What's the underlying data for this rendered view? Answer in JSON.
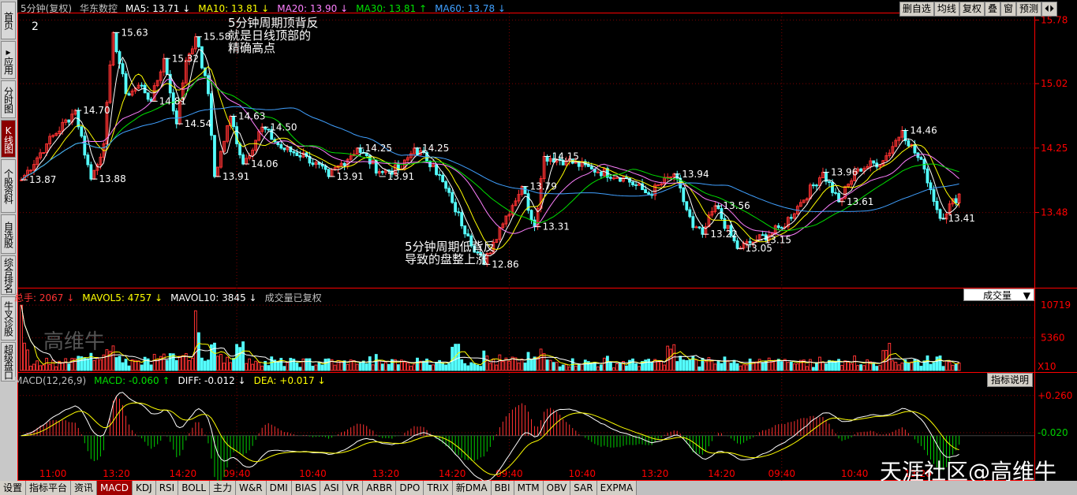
{
  "colors": {
    "up": "#ff3232",
    "down": "#54ffff",
    "ma5": "#ffffff",
    "ma10": "#ffff00",
    "ma20": "#ff80ff",
    "ma30": "#00e000",
    "ma60": "#40a0ff",
    "grid": "#800000",
    "axis": "#ff0000",
    "green": "#00d000"
  },
  "left_tabs": [
    {
      "label": "首页",
      "active": false
    },
    {
      "label": "▸应用",
      "active": false
    },
    {
      "label": "分时图",
      "active": false
    },
    {
      "label": "K线图",
      "active": true
    },
    {
      "label": "个股资料",
      "active": false
    },
    {
      "label": "自选股",
      "active": false
    },
    {
      "label": "综合排名",
      "active": false
    },
    {
      "label": "牛叉诊股",
      "active": false
    },
    {
      "label": "超级盘口",
      "active": false
    }
  ],
  "header": {
    "period": "5分钟(复权)",
    "stock": "华东数控",
    "ma5": "MA5: 13.71 ↓",
    "ma10": "MA10: 13.81 ↓",
    "ma20": "MA20: 13.90 ↓",
    "ma30": "MA30: 13.81 ↑",
    "ma60": "MA60: 13.78 ↓"
  },
  "top_buttons": [
    "删自选",
    "均线",
    "复权",
    "叠",
    "窗",
    "预测"
  ],
  "nav_icon": "prev-next-icon",
  "main_label": "2",
  "price_axis": [
    {
      "v": 15.78,
      "label": "15.78"
    },
    {
      "v": 15.02,
      "label": "15.02"
    },
    {
      "v": 14.25,
      "label": "14.25"
    },
    {
      "v": 13.48,
      "label": "13.48"
    }
  ],
  "annotations": [
    {
      "lines": [
        "5分钟周期顶背反",
        "就是日线顶部的",
        "精确高点"
      ]
    },
    {
      "lines": [
        "5分钟周期低背反",
        "导致的盘整上涨"
      ]
    }
  ],
  "watermark": "高维牛",
  "watermark2": "天涯社区@高维牛",
  "volume_header": {
    "total": "总手: 2067 ↓",
    "mavol5": "MAVOL5: 4757 ↓",
    "mavol10": "MAVOL10: 3845 ↓",
    "note": "成交量已复权"
  },
  "volume_dropdown": "成交量",
  "volume_axis": [
    {
      "v": 10719,
      "label": "10719"
    },
    {
      "v": 5360,
      "label": "5360"
    }
  ],
  "volume_unit": "X10",
  "macd_header": {
    "name": "MACD(12,26,9)",
    "macd": "MACD: -0.060 ↑",
    "diff": "DIFF: -0.012 ↓",
    "dea": "DEA: +0.017 ↓"
  },
  "macd_help": "指标说明",
  "macd_axis": [
    {
      "v": 0.26,
      "label": "+0.260"
    },
    {
      "v": 0.02,
      "label": "-0.020"
    }
  ],
  "time_labels": [
    {
      "i": 10,
      "label": "11:00"
    },
    {
      "i": 30,
      "label": "13:20"
    },
    {
      "i": 51,
      "label": "14:20"
    },
    {
      "i": 68,
      "label": "09:40"
    },
    {
      "i": 92,
      "label": "10:40"
    },
    {
      "i": 115,
      "label": "13:20"
    },
    {
      "i": 136,
      "label": "14:20"
    },
    {
      "i": 154,
      "label": "09:40"
    },
    {
      "i": 177,
      "label": "10:40"
    },
    {
      "i": 200,
      "label": "13:20"
    },
    {
      "i": 221,
      "label": "14:20"
    },
    {
      "i": 240,
      "label": "09:40"
    },
    {
      "i": 263,
      "label": "10:40"
    },
    {
      "i": 283,
      "label": "13:20"
    }
  ],
  "bottom_tabs": [
    {
      "label": "设置",
      "active": false
    },
    {
      "label": "指标平台",
      "active": false
    },
    {
      "label": "资讯",
      "active": false
    },
    {
      "label": "MACD",
      "active": true
    },
    {
      "label": "KDJ",
      "active": false
    },
    {
      "label": "RSI",
      "active": false
    },
    {
      "label": "BOLL",
      "active": false
    },
    {
      "label": "主力",
      "active": false
    },
    {
      "label": "W&R",
      "active": false
    },
    {
      "label": "DMI",
      "active": false
    },
    {
      "label": "BIAS",
      "active": false
    },
    {
      "label": "ASI",
      "active": false
    },
    {
      "label": "VR",
      "active": false
    },
    {
      "label": "ARBR",
      "active": false
    },
    {
      "label": "DPO",
      "active": false
    },
    {
      "label": "TRIX",
      "active": false
    },
    {
      "label": "新DMA",
      "active": false
    },
    {
      "label": "BBI",
      "active": false
    },
    {
      "label": "MTM",
      "active": false
    },
    {
      "label": "OBV",
      "active": false
    },
    {
      "label": "SAR",
      "active": false
    },
    {
      "label": "EXPMA",
      "active": false
    }
  ],
  "chart_data": {
    "type": "candlestick",
    "bars": 320,
    "price_range": [
      12.6,
      15.85
    ],
    "anchors": [
      [
        0,
        13.87
      ],
      [
        8,
        14.3
      ],
      [
        17,
        14.7
      ],
      [
        22,
        13.88
      ],
      [
        26,
        14.3
      ],
      [
        29,
        15.63
      ],
      [
        33,
        14.9
      ],
      [
        38,
        15.0
      ],
      [
        41,
        14.81
      ],
      [
        45,
        15.32
      ],
      [
        49,
        14.54
      ],
      [
        52,
        15.3
      ],
      [
        55,
        15.58
      ],
      [
        59,
        14.9
      ],
      [
        61,
        13.91
      ],
      [
        66,
        14.63
      ],
      [
        70,
        14.06
      ],
      [
        76,
        14.5
      ],
      [
        82,
        14.25
      ],
      [
        90,
        14.15
      ],
      [
        97,
        13.91
      ],
      [
        106,
        14.25
      ],
      [
        113,
        13.97
      ],
      [
        120,
        14.0
      ],
      [
        124,
        14.25
      ],
      [
        130,
        14.05
      ],
      [
        136,
        13.6
      ],
      [
        141,
        13.2
      ],
      [
        146,
        12.86
      ],
      [
        151,
        13.3
      ],
      [
        158,
        13.79
      ],
      [
        162,
        13.31
      ],
      [
        165,
        14.15
      ],
      [
        172,
        14.1
      ],
      [
        180,
        14.0
      ],
      [
        190,
        13.9
      ],
      [
        198,
        13.7
      ],
      [
        206,
        13.94
      ],
      [
        212,
        13.3
      ],
      [
        215,
        13.22
      ],
      [
        219,
        13.56
      ],
      [
        226,
        13.05
      ],
      [
        232,
        13.15
      ],
      [
        240,
        13.3
      ],
      [
        246,
        13.6
      ],
      [
        253,
        13.96
      ],
      [
        258,
        13.61
      ],
      [
        264,
        14.0
      ],
      [
        272,
        14.1
      ],
      [
        278,
        14.46
      ],
      [
        285,
        14.0
      ],
      [
        290,
        13.41
      ],
      [
        296,
        13.7
      ]
    ],
    "labels": [
      {
        "i": 0,
        "v": 13.87,
        "label": "13.87"
      },
      {
        "i": 17,
        "v": 14.7,
        "label": "14.70"
      },
      {
        "i": 22,
        "v": 13.88,
        "label": "13.88"
      },
      {
        "i": 29,
        "v": 15.63,
        "label": "15.63"
      },
      {
        "i": 41,
        "v": 14.81,
        "label": "14.81"
      },
      {
        "i": 45,
        "v": 15.32,
        "label": "15.32"
      },
      {
        "i": 49,
        "v": 14.54,
        "label": "14.54"
      },
      {
        "i": 55,
        "v": 15.58,
        "label": "15.58"
      },
      {
        "i": 61,
        "v": 13.91,
        "label": "13.91"
      },
      {
        "i": 66,
        "v": 14.63,
        "label": "14.63"
      },
      {
        "i": 70,
        "v": 14.06,
        "label": "14.06"
      },
      {
        "i": 76,
        "v": 14.5,
        "label": "14.50"
      },
      {
        "i": 97,
        "v": 13.91,
        "label": "13.91"
      },
      {
        "i": 106,
        "v": 14.25,
        "label": "14.25"
      },
      {
        "i": 113,
        "v": 13.91,
        "label": "13.91"
      },
      {
        "i": 124,
        "v": 14.25,
        "label": "14.25"
      },
      {
        "i": 146,
        "v": 12.86,
        "label": "12.86"
      },
      {
        "i": 158,
        "v": 13.79,
        "label": "13.79"
      },
      {
        "i": 162,
        "v": 13.31,
        "label": "13.31"
      },
      {
        "i": 165,
        "v": 14.15,
        "label": "14.15"
      },
      {
        "i": 206,
        "v": 13.94,
        "label": "13.94"
      },
      {
        "i": 215,
        "v": 13.22,
        "label": "13.22"
      },
      {
        "i": 219,
        "v": 13.56,
        "label": "13.56"
      },
      {
        "i": 226,
        "v": 13.05,
        "label": "13.05"
      },
      {
        "i": 232,
        "v": 13.15,
        "label": "13.15"
      },
      {
        "i": 253,
        "v": 13.96,
        "label": "13.96"
      },
      {
        "i": 258,
        "v": 13.61,
        "label": "13.61"
      },
      {
        "i": 278,
        "v": 14.46,
        "label": "14.46"
      },
      {
        "i": 290,
        "v": 13.41,
        "label": "13.41"
      }
    ],
    "volume_range": [
      0,
      11000
    ],
    "macd_range": [
      -0.2,
      0.32
    ]
  }
}
